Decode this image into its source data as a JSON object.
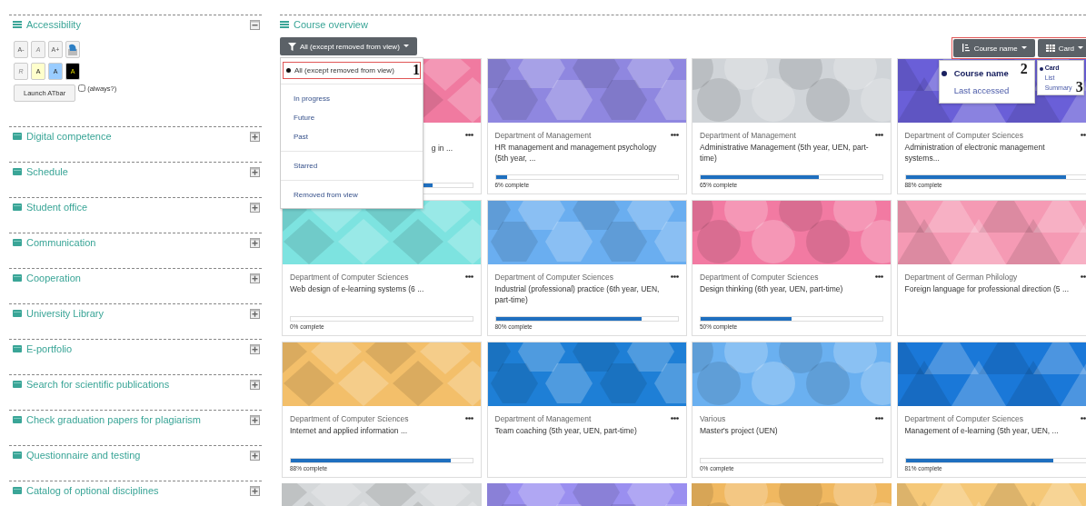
{
  "sidebar": {
    "accessibility": {
      "title": "Accessibility",
      "expanded": true,
      "text_buttons": [
        {
          "label": "A-",
          "disabled": false
        },
        {
          "label": "A",
          "disabled": true
        },
        {
          "label": "A+",
          "disabled": false
        }
      ],
      "color_buttons": [
        {
          "label": "R",
          "disabled": true,
          "color": "#f4f4f4"
        },
        {
          "label": "A",
          "disabled": false,
          "color": "#ffffcc"
        },
        {
          "label": "A",
          "disabled": false,
          "color": "#99ccff"
        },
        {
          "label": "A",
          "disabled": false,
          "color": "#000000"
        }
      ],
      "launch_button": "Launch ATbar",
      "always": {
        "label": "(always?)",
        "checked": false
      }
    },
    "blocks": [
      {
        "title": "Digital competence",
        "expanded": false
      },
      {
        "title": "Schedule",
        "expanded": false
      },
      {
        "title": "Student office",
        "expanded": false
      },
      {
        "title": "Communication",
        "expanded": false
      },
      {
        "title": "Cooperation",
        "expanded": false
      },
      {
        "title": "University Library",
        "expanded": false
      },
      {
        "title": "E-portfolio",
        "expanded": false
      },
      {
        "title": "Search for scientific publications",
        "expanded": false
      },
      {
        "title": "Check graduation papers for plagiarism",
        "expanded": false
      },
      {
        "title": "Questionnaire and testing",
        "expanded": false
      },
      {
        "title": "Catalog of optional disciplines",
        "expanded": false
      }
    ]
  },
  "main": {
    "title": "Course overview",
    "filter": {
      "label": "All (except removed from view)",
      "groups": [
        [
          {
            "label": "All (except removed from view)",
            "selected": true
          }
        ],
        [
          {
            "label": "In progress",
            "selected": false
          },
          {
            "label": "Future",
            "selected": false
          },
          {
            "label": "Past",
            "selected": false
          }
        ],
        [
          {
            "label": "Starred",
            "selected": false
          }
        ],
        [
          {
            "label": "Removed from view",
            "selected": false
          }
        ]
      ]
    },
    "sort": {
      "label": "Course name",
      "options": [
        {
          "label": "Course name",
          "selected": true
        },
        {
          "label": "Last accessed",
          "selected": false
        }
      ]
    },
    "view": {
      "label": "Card",
      "options": [
        {
          "label": "Card",
          "selected": true
        },
        {
          "label": "List",
          "selected": false
        },
        {
          "label": "Summary",
          "selected": false
        }
      ]
    },
    "annotations": [
      "1",
      "2",
      "3"
    ],
    "cards": [
      {
        "kind": "covered",
        "name": "g in ...",
        "level": 0.78
      },
      {
        "kind": "course",
        "department": "Department of Management",
        "name": "HR management and management psychology (5th year, ...",
        "level": 0.06,
        "progress": "6% complete"
      },
      {
        "kind": "course",
        "department": "Department of Management",
        "name": "Administrative Management (5th year, UEN, part-time)",
        "level": 0.65,
        "progress": "65% complete"
      },
      {
        "kind": "course",
        "department": "Department of Computer Sciences",
        "name": "Administration of electronic management systems...",
        "level": 0.88,
        "progress": "88% complete"
      },
      {
        "kind": "course",
        "department": "Department of Computer Sciences",
        "name": "Web design of e-learning systems (6 ...",
        "level": 0,
        "progress": "0% complete"
      },
      {
        "kind": "course",
        "department": "Department of Computer Sciences",
        "name": "Industrial (professional) practice (6th year, UEN, part-time)",
        "level": 0.8,
        "progress": "80% complete"
      },
      {
        "kind": "course",
        "department": "Department of Computer Sciences",
        "name": "Design thinking (6th year, UEN, part-time)",
        "level": 0.5,
        "progress": "50% complete"
      },
      {
        "kind": "course",
        "department": "Department of German Philology",
        "name": "Foreign language for professional direction (5 ..."
      },
      {
        "kind": "course",
        "department": "Department of Computer Sciences",
        "name": "Internet and applied information ...",
        "level": 0.88,
        "progress": "88% complete"
      },
      {
        "kind": "course",
        "department": "Department of Management",
        "name": "Team coaching (5th year, UEN, part-time)"
      },
      {
        "kind": "course",
        "department": "Various",
        "name": "Master's project (UEN)",
        "level": 0,
        "progress": "0% complete"
      },
      {
        "kind": "course",
        "department": "Department of Computer Sciences",
        "name": "Management of e-learning (5th year, UEN, ...",
        "level": 0.81,
        "progress": "81% complete"
      },
      {
        "kind": "picture"
      },
      {
        "kind": "picture"
      },
      {
        "kind": "picture"
      },
      {
        "kind": "picture"
      }
    ]
  }
}
